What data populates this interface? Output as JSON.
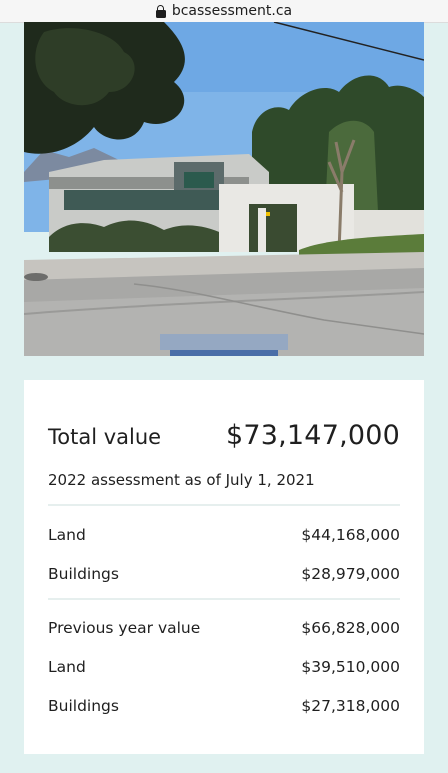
{
  "browser": {
    "url": "bcassessment.ca"
  },
  "assessment": {
    "total_label": "Total value",
    "total_value": "$73,147,000",
    "note": "2022 assessment as of July 1, 2021",
    "current": {
      "land_label": "Land",
      "land_value": "$44,168,000",
      "buildings_label": "Buildings",
      "buildings_value": "$28,979,000"
    },
    "previous": {
      "label": "Previous year value",
      "value": "$66,828,000",
      "land_label": "Land",
      "land_value": "$39,510,000",
      "buildings_label": "Buildings",
      "buildings_value": "$27,318,000"
    }
  },
  "colors": {
    "page_background": "#e0f1f0",
    "card_background": "#ffffff",
    "text": "#1f1f1f",
    "divider": "#e6efee"
  }
}
